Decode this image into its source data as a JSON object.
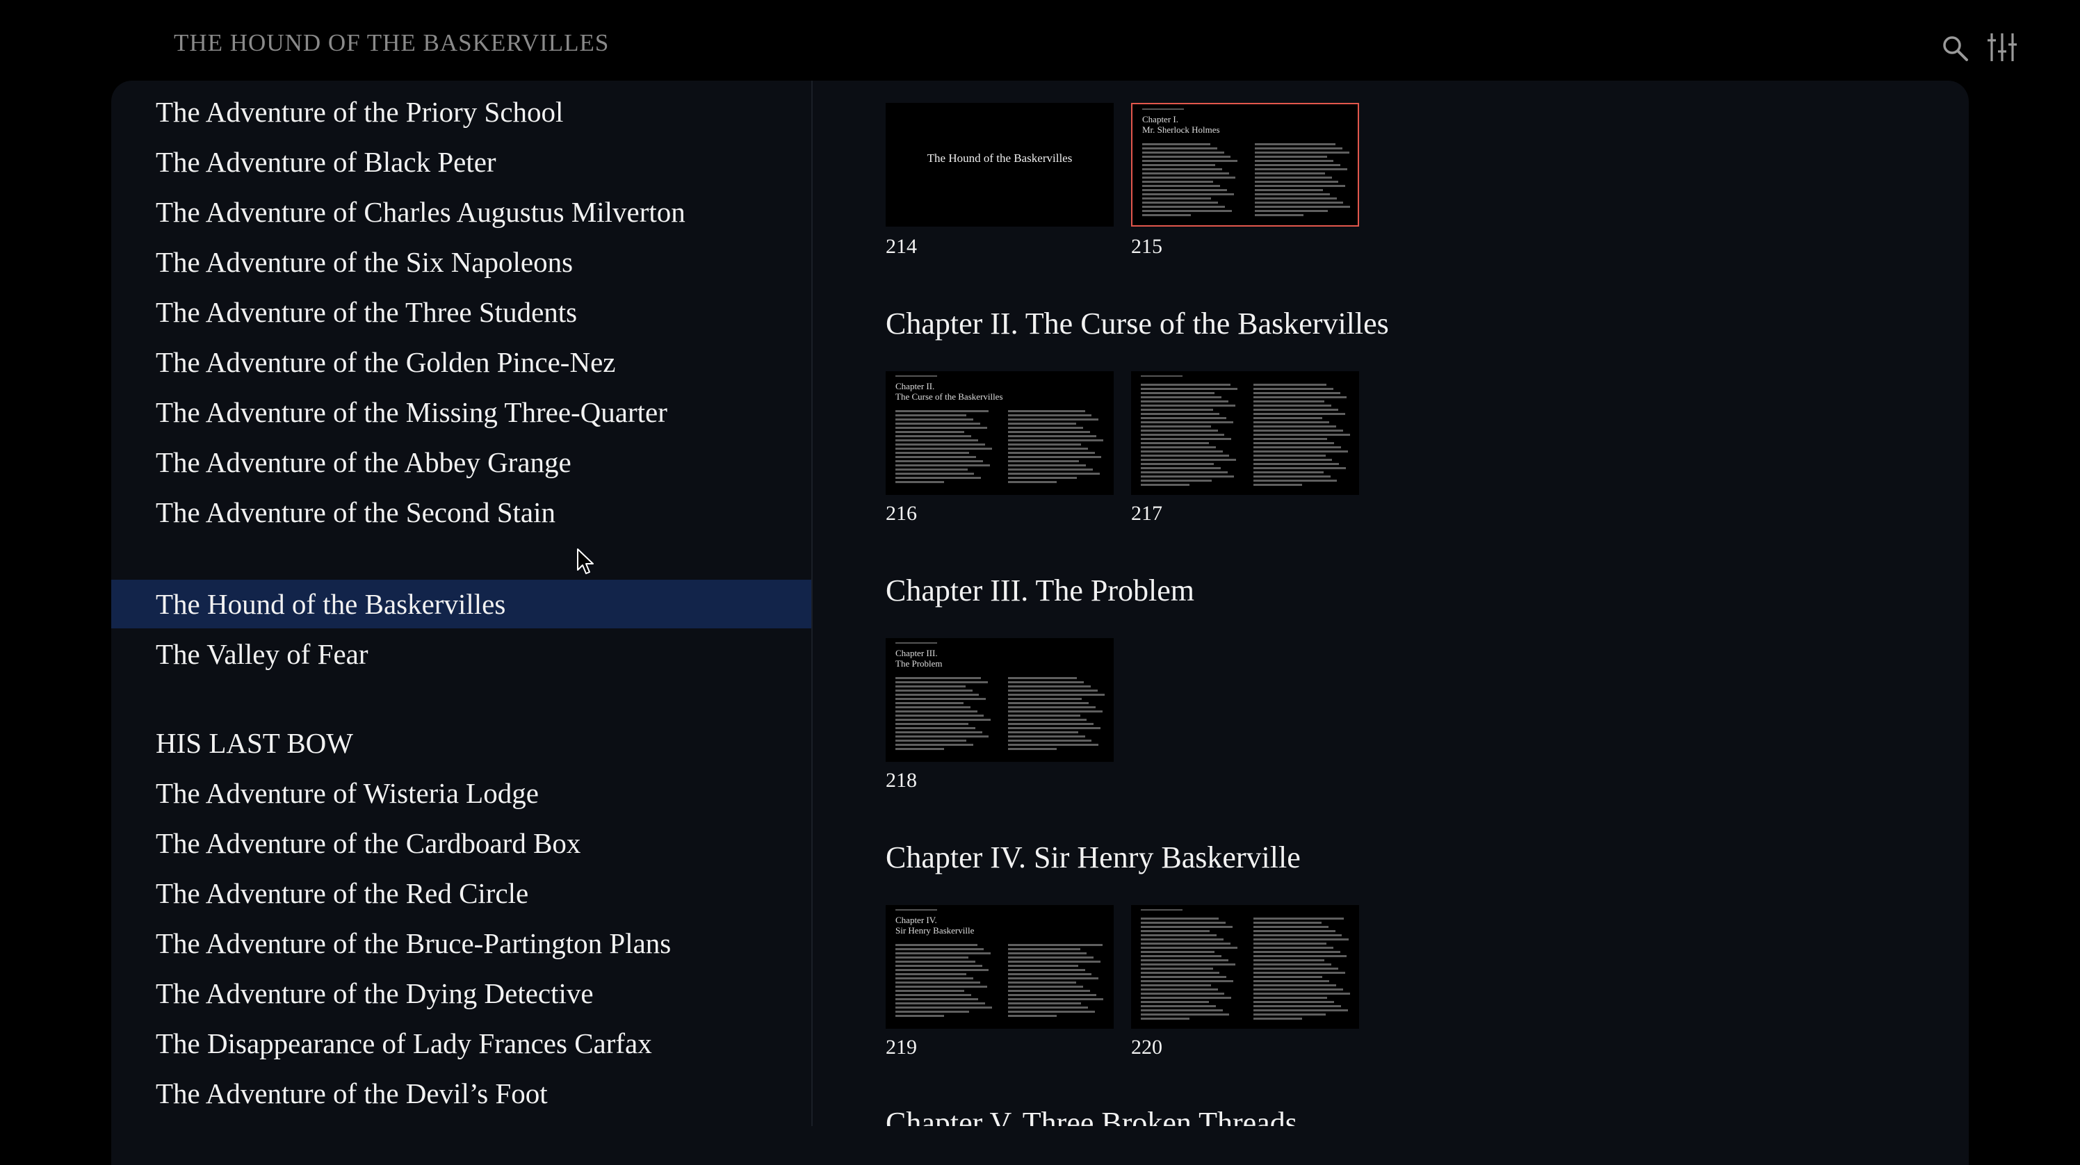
{
  "header": {
    "title": "THE HOUND OF THE BASKERVILLES"
  },
  "icons": {
    "search": "search-icon",
    "settings": "sliders-icon"
  },
  "toc": {
    "group1": [
      "The Adventure of the Priory School",
      "The Adventure of Black Peter",
      "The Adventure of Charles Augustus Milverton",
      "The Adventure of the Six Napoleons",
      "The Adventure of the Three Students",
      "The Adventure of the Golden Pince-Nez",
      "The Adventure of the Missing Three-Quarter",
      "The Adventure of the Abbey Grange",
      "The Adventure of the Second Stain"
    ],
    "group2": [
      "The Hound of the Baskervilles",
      "The Valley of Fear"
    ],
    "active": "The Hound of the Baskervilles",
    "section_heading": "HIS LAST BOW",
    "group3": [
      "The Adventure of Wisteria Lodge",
      "The Adventure of the Cardboard Box",
      "The Adventure of the Red Circle",
      "The Adventure of the Bruce-Partington Plans",
      "The Adventure of the Dying Detective",
      "The Disappearance of Lady Frances Carfax",
      "The Adventure of the Devil’s Foot"
    ]
  },
  "content": {
    "chapters": [
      {
        "title": "Chapter II. The Curse of the Baskervilles"
      },
      {
        "title": "Chapter III. The Problem"
      },
      {
        "title": "Chapter IV. Sir Henry Baskerville"
      },
      {
        "title": "Chapter V. Three Broken Threads"
      }
    ],
    "pages": [
      {
        "num": "214",
        "label": "The Hound of the Baskervilles"
      },
      {
        "num": "215",
        "label": "Chapter I.\nMr. Sherlock Holmes",
        "selected": true
      },
      {
        "num": "216",
        "label": "Chapter II.\nThe Curse of the Baskervilles"
      },
      {
        "num": "217",
        "label": ""
      },
      {
        "num": "218",
        "label": "Chapter III.\nThe Problem"
      },
      {
        "num": "219",
        "label": "Chapter IV.\nSir Henry Baskerville"
      },
      {
        "num": "220",
        "label": ""
      }
    ]
  },
  "colors": {
    "selected_border": "#e2574c",
    "active_bg": "#12244a",
    "panel_bg": "#0b0e14"
  }
}
